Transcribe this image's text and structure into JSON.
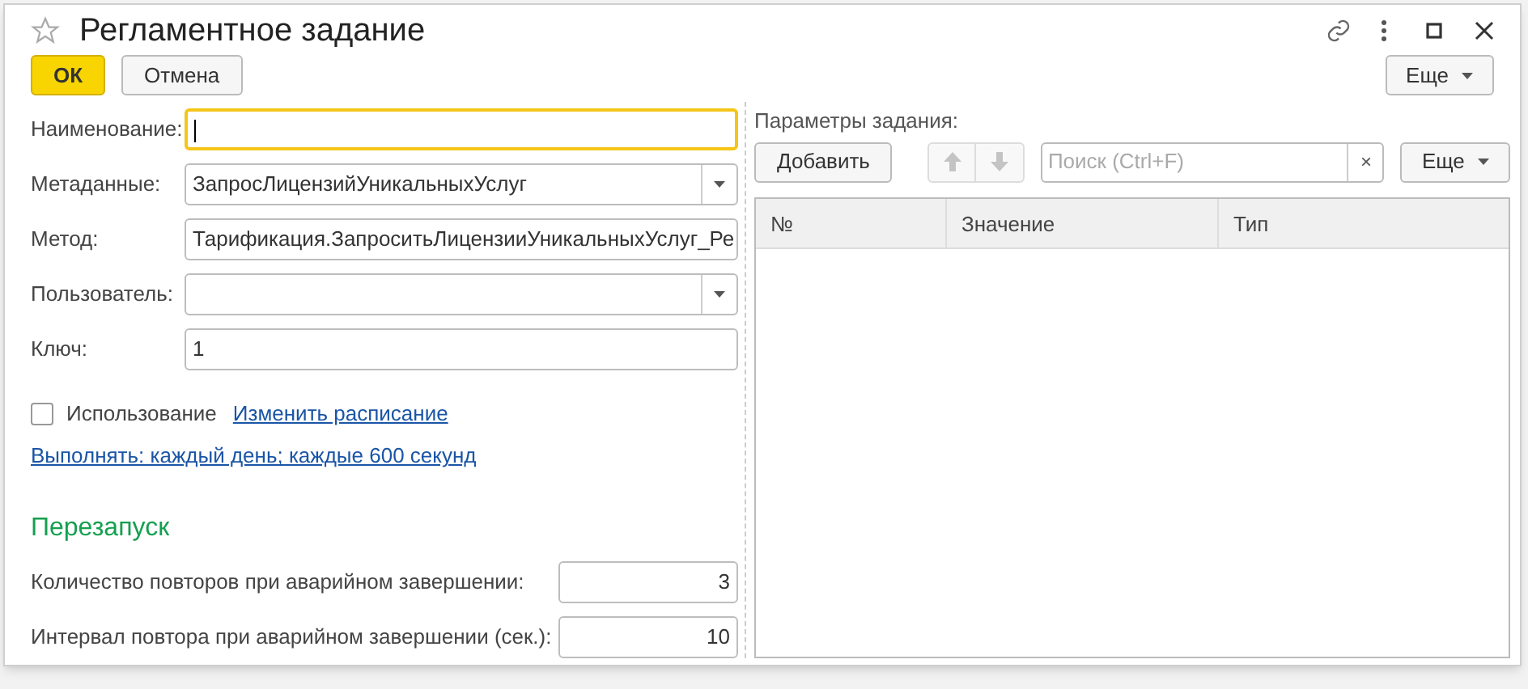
{
  "window": {
    "title": "Регламентное задание",
    "favorite": false
  },
  "command_bar": {
    "ok": "ОК",
    "cancel": "Отмена",
    "more": "Еще"
  },
  "fields": [
    {
      "kind": "text",
      "label": "Наименование:",
      "focused": true
    },
    {
      "kind": "select",
      "label": "Метаданные:",
      "value": "ЗапросЛицензийУникальныхУслуг",
      "focused": false
    },
    {
      "kind": "text",
      "label": "Метод:",
      "value": "Тарификация.ЗапроситьЛицензииУникальныхУслуг_Ре",
      "focused": false
    },
    {
      "kind": "select",
      "label": "Пользователь:",
      "focused": false
    },
    {
      "kind": "text",
      "label": "Ключ:",
      "value": "1",
      "focused": false
    }
  ],
  "usage": {
    "label": "Использование",
    "checked": false,
    "link": "Изменить расписание"
  },
  "schedule_link": "Выполнять: каждый день; каждые 600 секунд",
  "restart": {
    "title": "Перезапуск",
    "fields": [
      {
        "label": "Количество повторов при аварийном завершении:",
        "value": "3"
      },
      {
        "label": "Интервал повтора при аварийном завершении (сек.):",
        "value": "10"
      }
    ]
  },
  "parameters": {
    "title": "Параметры задания:",
    "add": "Добавить",
    "search": {
      "placeholder": "Поиск (Ctrl+F)",
      "clear": "×"
    },
    "more": "Еще",
    "table": {
      "columns": [
        "№",
        "Значение",
        "Тип"
      ]
    }
  }
}
